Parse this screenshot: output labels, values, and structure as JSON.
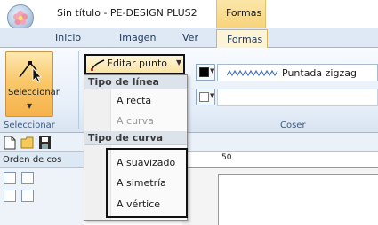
{
  "window": {
    "title": "Sin título - PE-DESIGN PLUS2",
    "context_tab_group": "Formas"
  },
  "tabs": [
    {
      "label": "Inicio",
      "active": false
    },
    {
      "label": "Imagen",
      "active": false
    },
    {
      "label": "Ver",
      "active": false
    },
    {
      "label": "Formas",
      "active": true
    }
  ],
  "ribbon": {
    "select_button": {
      "label": "Seleccionar",
      "icon": "select-arrow-icon"
    },
    "select_group_label": "Seleccionar",
    "edit_point_button": {
      "label": "Editar punto",
      "icon": "edit-point-icon"
    },
    "line_color_swatch": {
      "color": "#000000"
    },
    "stitch_type": {
      "label": "Puntada zigzag",
      "icon": "zigzag-stitch-icon",
      "color": "#3f6fb5"
    },
    "fill_swatch": {
      "color": "#ffffff"
    },
    "sew_group_label": "Coser"
  },
  "panel": {
    "title": "Orden de cos"
  },
  "ruler": {
    "mark": "50"
  },
  "menu": {
    "line_type_header": "Tipo de línea",
    "line_items": [
      {
        "label": "A recta",
        "enabled": true
      },
      {
        "label": "A curva",
        "enabled": false
      }
    ],
    "curve_type_header": "Tipo de curva",
    "curve_items": [
      {
        "label": "A suavizado",
        "enabled": true
      },
      {
        "label": "A simetría",
        "enabled": true
      },
      {
        "label": "A vértice",
        "enabled": true
      }
    ]
  },
  "colors": {
    "accent_orange": "#f6b24b",
    "context_tab": "#f7d37b",
    "ribbon_blue": "#dfe9f5",
    "highlight_border": "#111111"
  }
}
